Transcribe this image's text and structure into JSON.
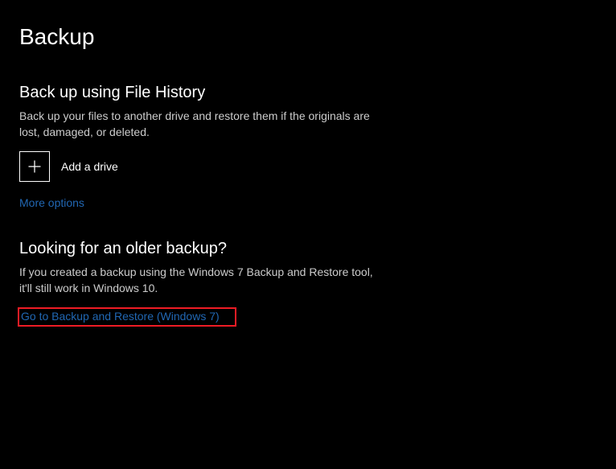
{
  "page": {
    "title": "Backup"
  },
  "file_history": {
    "heading": "Back up using File History",
    "description": "Back up your files to another drive and restore them if the originals are lost, damaged, or deleted.",
    "add_drive_label": "Add a drive",
    "more_options_link": "More options"
  },
  "older_backup": {
    "heading": "Looking for an older backup?",
    "description": "If you created a backup using the Windows 7 Backup and Restore tool, it'll still work in Windows 10.",
    "legacy_link": "Go to Backup and Restore (Windows 7)"
  },
  "colors": {
    "link": "#2167b3",
    "highlight_border": "#ee1c25"
  }
}
